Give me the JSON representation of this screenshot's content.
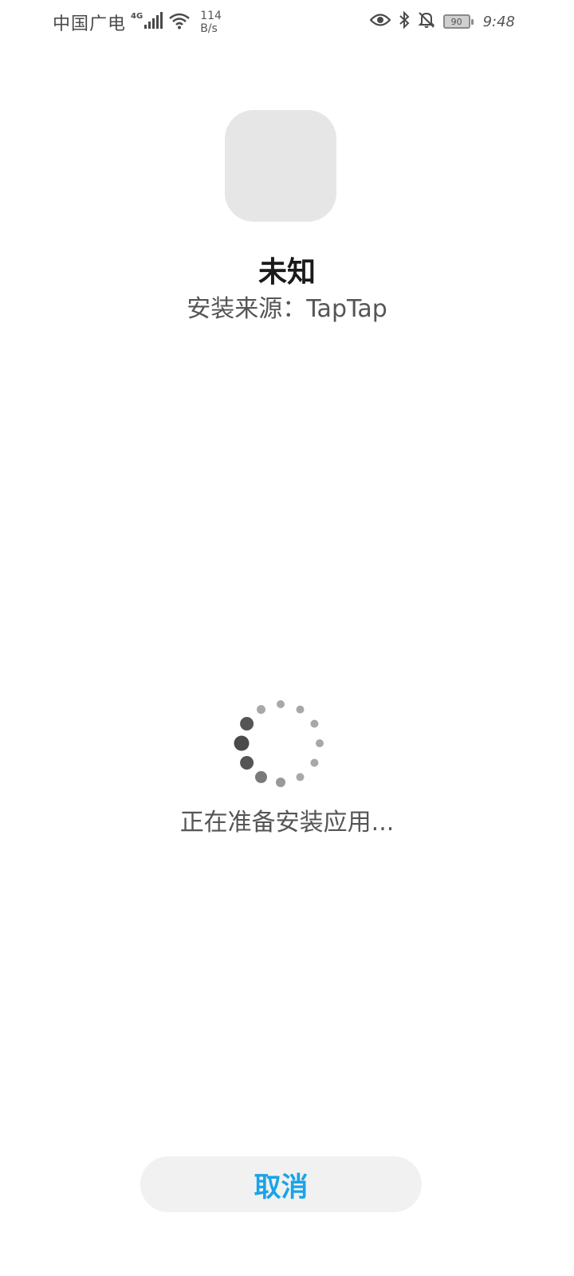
{
  "status_bar": {
    "carrier": "中国广电",
    "network_type": "4G",
    "speed_value": "114",
    "speed_unit": "B/s",
    "battery_level": "90",
    "time": "9:48",
    "icons": [
      "signal-icon",
      "wifi-icon",
      "eye-icon",
      "bluetooth-icon",
      "bell-muted-icon",
      "battery-icon"
    ]
  },
  "app": {
    "name": "未知",
    "install_source": "安装来源：TapTap"
  },
  "progress": {
    "status_text": "正在准备安装应用..."
  },
  "actions": {
    "cancel_label": "取消"
  },
  "colors": {
    "accent": "#1aa3e8",
    "icon_placeholder": "#e6e6e6",
    "button_bg": "#f1f1f1"
  }
}
